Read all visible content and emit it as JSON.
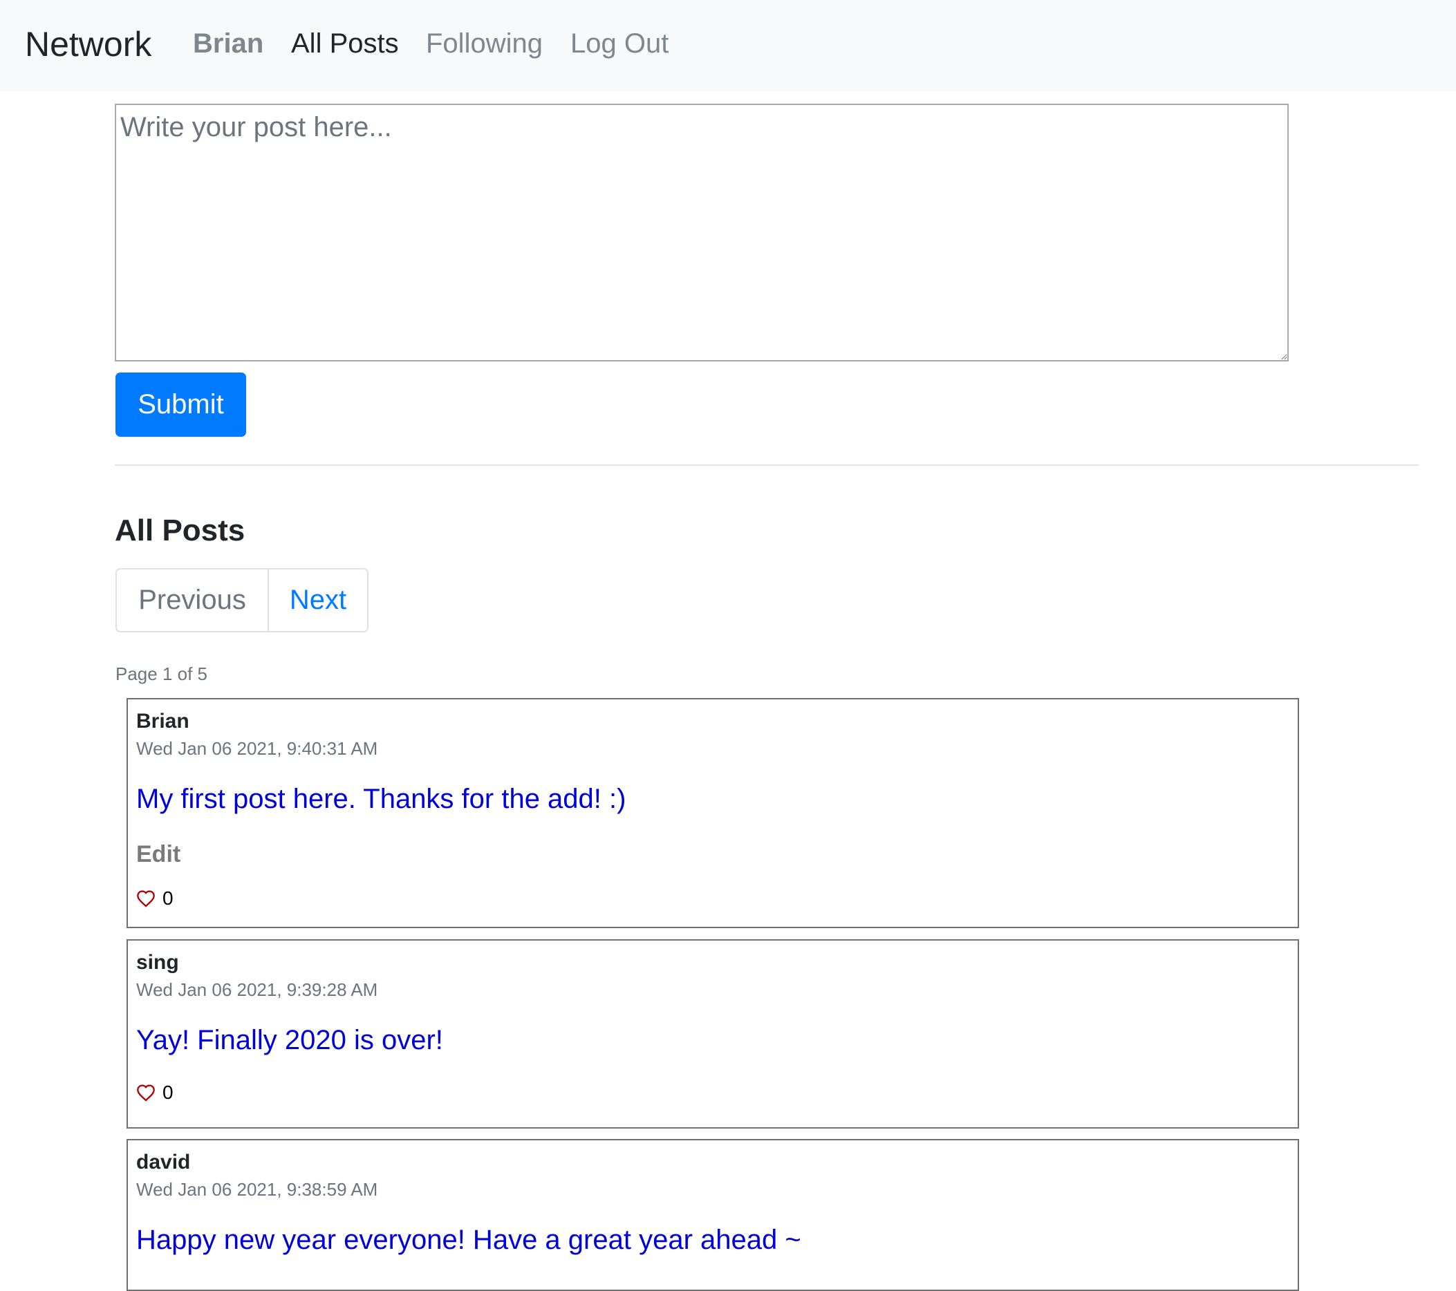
{
  "navbar": {
    "brand": "Network",
    "user": "Brian",
    "all_posts": "All Posts",
    "following": "Following",
    "logout": "Log Out"
  },
  "composer": {
    "placeholder": "Write your post here...",
    "value": "",
    "submit_label": "Submit"
  },
  "feed": {
    "heading": "All Posts",
    "pagination": {
      "previous": "Previous",
      "next": "Next"
    },
    "page_info": "Page 1 of 5",
    "posts": [
      {
        "author": "Brian",
        "timestamp": "Wed Jan 06 2021, 9:40:31 AM",
        "content": "My first post here. Thanks for the add! :)",
        "edit_label": "Edit",
        "likes": "0"
      },
      {
        "author": "sing",
        "timestamp": "Wed Jan 06 2021, 9:39:28 AM",
        "content": "Yay! Finally 2020 is over!",
        "likes": "0"
      },
      {
        "author": "david",
        "timestamp": "Wed Jan 06 2021, 9:38:59 AM",
        "content": "Happy new year everyone! Have a great year ahead ~"
      }
    ]
  },
  "colors": {
    "navbar_bg": "#f8f9fa",
    "primary": "#007bff",
    "post_text": "#0000d9",
    "heart": "#b00000",
    "muted": "#6c757d"
  },
  "icons": {
    "like": "heart-outline-icon"
  }
}
